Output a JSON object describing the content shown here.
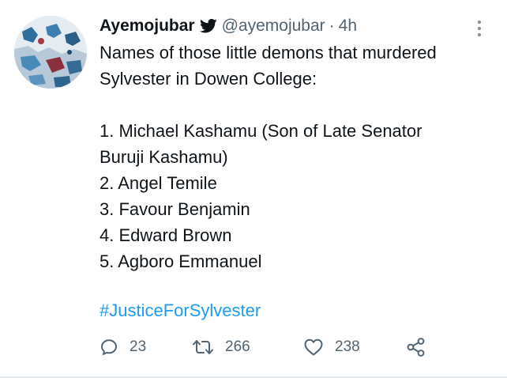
{
  "tweet": {
    "display_name": "Ayemojubar",
    "handle": "@ayemojubar",
    "separator": "·",
    "time": "4h",
    "intro_line_1": "Names of those little demons that murdered",
    "intro_line_2": "Sylvester in Dowen College:",
    "list": [
      "1. Michael Kashamu (Son of Late Senator",
      "Buruji Kashamu)",
      "2. Angel Temile",
      "3. Favour Benjamin",
      "4. Edward Brown",
      "5. Agboro Emmanuel"
    ],
    "hashtag": "#JusticeForSylvester"
  },
  "actions": {
    "reply_count": "23",
    "retweet_count": "266",
    "like_count": "238"
  },
  "icons": {
    "verified": "bird-icon",
    "reply": "reply-icon",
    "retweet": "retweet-icon",
    "like": "heart-icon",
    "share": "share-icon",
    "more": "more-icon"
  },
  "colors": {
    "text": "#0f1419",
    "secondary": "#536471",
    "link": "#1d9bf0"
  }
}
